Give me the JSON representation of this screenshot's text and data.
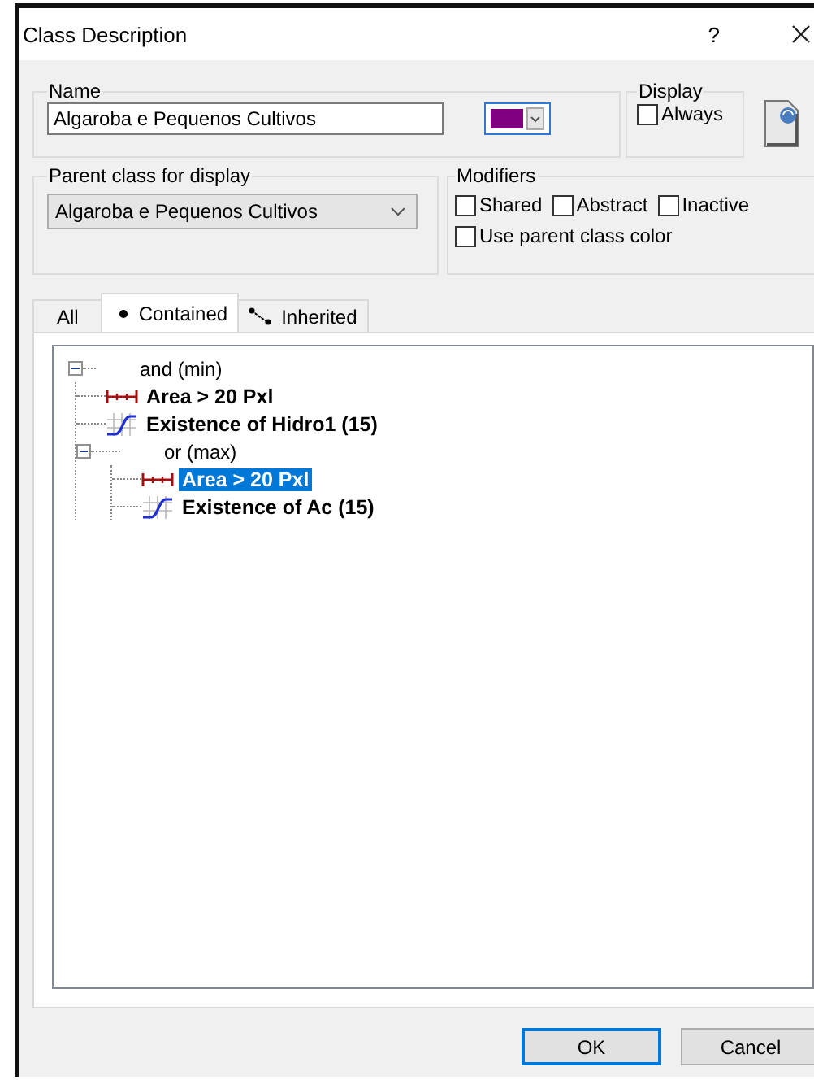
{
  "window": {
    "title": "Class Description",
    "help_button": "?"
  },
  "name_group": {
    "label": "Name",
    "value": "Algaroba e Pequenos Cultivos",
    "color": "#800080"
  },
  "display_group": {
    "label": "Display",
    "always": {
      "label": "Always",
      "checked": false
    }
  },
  "parent_group": {
    "label": "Parent class for display",
    "value": "Algaroba e Pequenos Cultivos"
  },
  "modifiers_group": {
    "label": "Modifiers",
    "options": [
      {
        "label": "Shared",
        "checked": false
      },
      {
        "label": "Abstract",
        "checked": false
      },
      {
        "label": "Inactive",
        "checked": false
      },
      {
        "label": "Use parent class color",
        "checked": false
      }
    ]
  },
  "tabs": [
    {
      "label": "All",
      "kind": "all",
      "selected": false
    },
    {
      "label": "Contained",
      "kind": "contained",
      "selected": true
    },
    {
      "label": "Inherited",
      "kind": "inherited",
      "selected": false
    }
  ],
  "tree": [
    {
      "label": "and (min)",
      "kind": "operator",
      "expanded": true,
      "selected": false,
      "children": [
        {
          "label": "Area > 20 Pxl",
          "kind": "range",
          "selected": false
        },
        {
          "label": "Existence of Hidro1 (15)",
          "kind": "curve",
          "selected": false
        },
        {
          "label": "or (max)",
          "kind": "operator",
          "expanded": true,
          "selected": false,
          "children": [
            {
              "label": "Area > 20 Pxl",
              "kind": "range",
              "selected": true
            },
            {
              "label": "Existence of Ac (15)",
              "kind": "curve",
              "selected": false
            }
          ]
        }
      ]
    }
  ],
  "buttons": [
    {
      "label": "OK",
      "default": true
    },
    {
      "label": "Cancel",
      "default": false
    }
  ]
}
